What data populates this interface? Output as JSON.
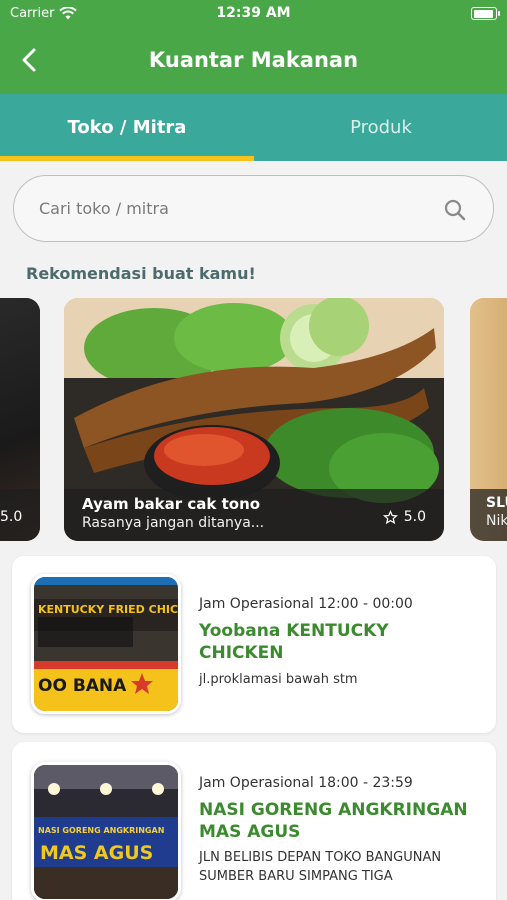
{
  "status_bar": {
    "carrier": "Carrier",
    "time": "12:39 AM"
  },
  "nav": {
    "title": "Kuantar Makanan"
  },
  "tabs": [
    {
      "label": "Toko / Mitra",
      "active": true
    },
    {
      "label": "Produk",
      "active": false
    }
  ],
  "search": {
    "placeholder": "Cari toko / mitra"
  },
  "section": {
    "title": "Rekomendasi buat kamu!"
  },
  "recommendations": [
    {
      "rating": "5.0"
    },
    {
      "name": "Ayam bakar cak tono",
      "description": "Rasanya jangan ditanya...",
      "rating": "5.0"
    },
    {
      "name": "SLU",
      "description": "Nik"
    }
  ],
  "stores": [
    {
      "hours": "Jam Operasional 12:00 - 00:00",
      "name_line1": "Yoobana KENTUCKY",
      "name_line2": "CHICKEN",
      "address_line1": "jl.proklamasi bawah stm",
      "address_line2": "",
      "thumb_sign": "KENTUCKY FRIED CHICKEN",
      "thumb_caption": "OO BANA"
    },
    {
      "hours": "Jam Operasional 18:00 - 23:59",
      "name_line1": "NASI GORENG ANGKRINGAN",
      "name_line2": "MAS AGUS",
      "address_line1": "JLN BELIBIS DEPAN TOKO BANGUNAN",
      "address_line2": "SUMBER BARU SIMPANG TIGA",
      "thumb_sign": "NASI GORENG ANGKRINGAN",
      "thumb_caption": "MAS AGUS"
    }
  ],
  "colors": {
    "header": "#4aa748",
    "tabs": "#3aa89a",
    "indicator": "#f7c21a",
    "store_name": "#3b8a2e"
  }
}
